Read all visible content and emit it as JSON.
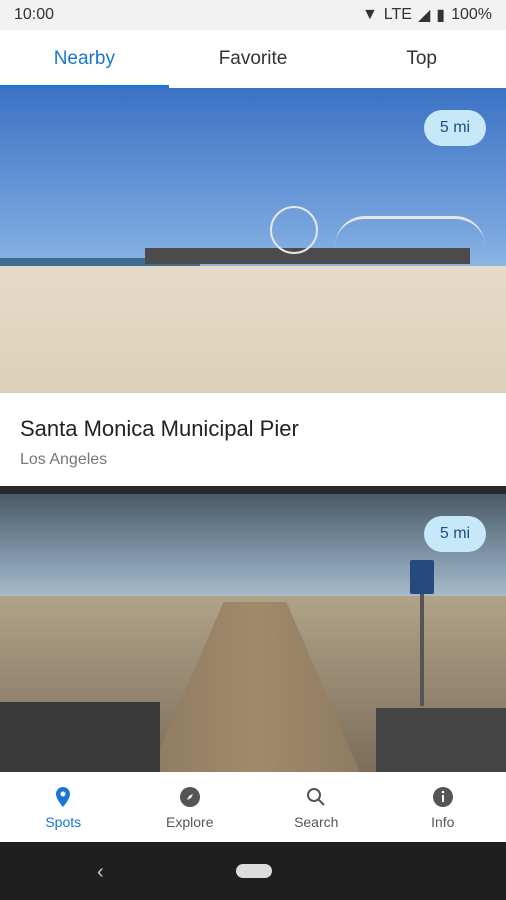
{
  "status_bar": {
    "time": "10:00",
    "network": "LTE",
    "battery": "100%"
  },
  "tabs": [
    "Nearby",
    "Favorite",
    "Top"
  ],
  "spots": [
    {
      "title": "Santa Monica Municipal Pier",
      "subtitle": "Los Angeles",
      "distance": "5 mi"
    },
    {
      "distance": "5 mi"
    }
  ],
  "bottom_nav": [
    {
      "label": "Spots",
      "icon": "location-pin-icon"
    },
    {
      "label": "Explore",
      "icon": "compass-icon"
    },
    {
      "label": "Search",
      "icon": "search-icon"
    },
    {
      "label": "Info",
      "icon": "info-icon"
    }
  ],
  "colors": {
    "accent": "#1976d2",
    "badge_bg": "#c6e8f8"
  }
}
